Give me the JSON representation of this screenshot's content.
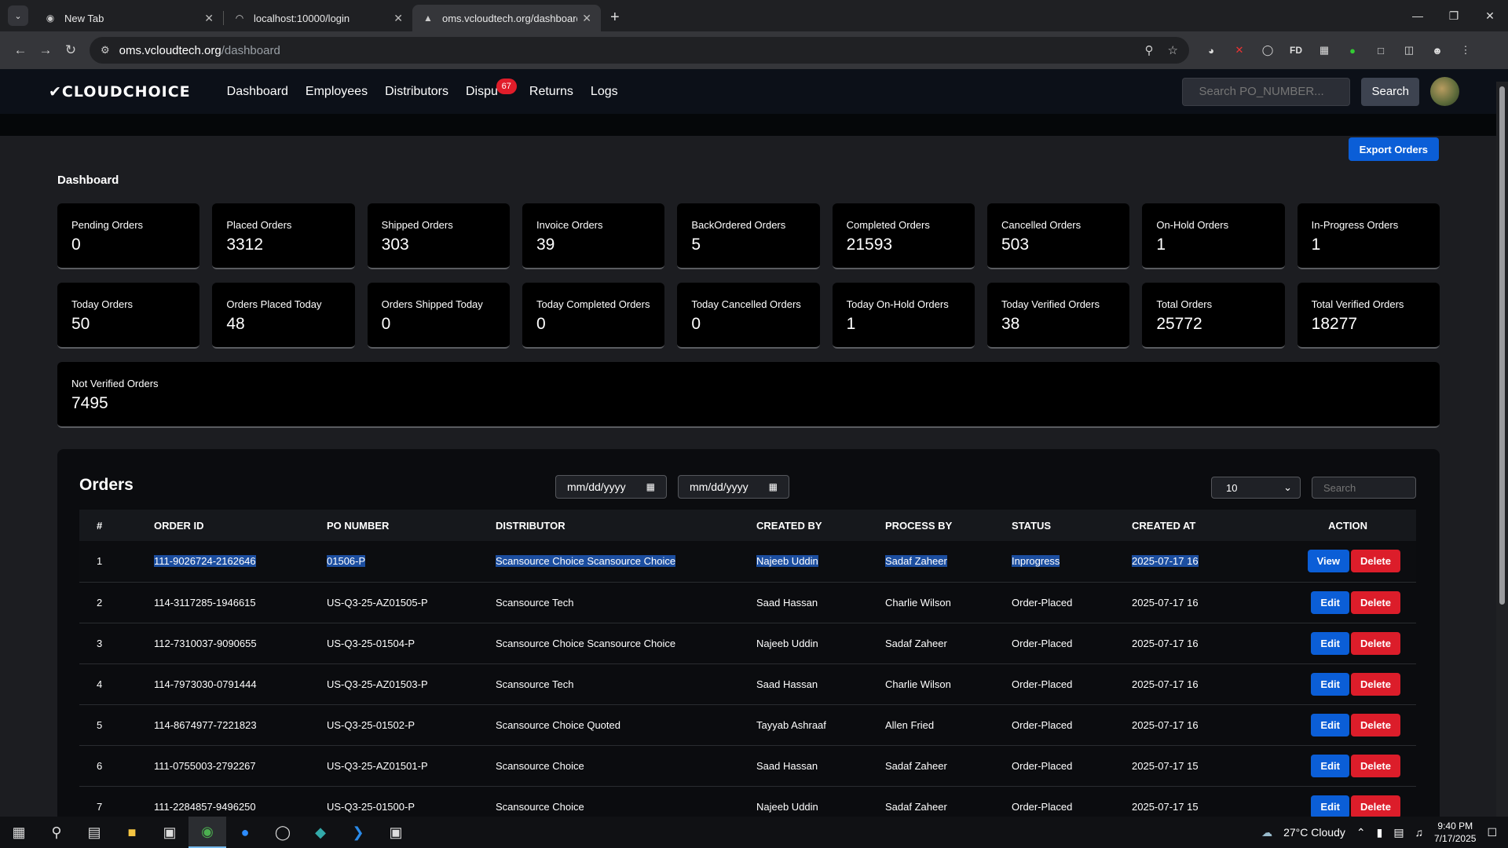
{
  "browser": {
    "tabs": [
      {
        "title": "New Tab",
        "icon": "chrome-icon",
        "active": false
      },
      {
        "title": "localhost:10000/login",
        "icon": "loading-icon",
        "active": false
      },
      {
        "title": "oms.vcloudtech.org/dashboard",
        "icon": "site-icon",
        "active": true
      }
    ],
    "url_host": "oms.vcloudtech.org",
    "url_path": "/dashboard"
  },
  "nav": {
    "logo": "CLOUDCHOICE",
    "links": [
      "Dashboard",
      "Employees",
      "Distributors",
      "Dispu",
      "Returns",
      "Logs"
    ],
    "disputes_badge": "67",
    "search_placeholder": "Search PO_NUMBER...",
    "search_button": "Search"
  },
  "dashboard": {
    "export_button": "Export Orders",
    "title": "Dashboard",
    "cards": [
      {
        "label": "Pending Orders",
        "value": "0"
      },
      {
        "label": "Placed Orders",
        "value": "3312"
      },
      {
        "label": "Shipped Orders",
        "value": "303"
      },
      {
        "label": "Invoice Orders",
        "value": "39"
      },
      {
        "label": "BackOrdered Orders",
        "value": "5"
      },
      {
        "label": "Completed Orders",
        "value": "21593"
      },
      {
        "label": "Cancelled Orders",
        "value": "503"
      },
      {
        "label": "On-Hold Orders",
        "value": "1"
      },
      {
        "label": "In-Progress Orders",
        "value": "1"
      },
      {
        "label": "Today Orders",
        "value": "50"
      },
      {
        "label": "Orders Placed Today",
        "value": "48"
      },
      {
        "label": "Orders Shipped Today",
        "value": "0"
      },
      {
        "label": "Today Completed Orders",
        "value": "0"
      },
      {
        "label": "Today Cancelled Orders",
        "value": "0"
      },
      {
        "label": "Today On-Hold Orders",
        "value": "1"
      },
      {
        "label": "Today Verified Orders",
        "value": "38"
      },
      {
        "label": "Total Orders",
        "value": "25772"
      },
      {
        "label": "Total Verified Orders",
        "value": "18277"
      },
      {
        "label": "Not Verified Orders",
        "value": "7495"
      }
    ]
  },
  "orders": {
    "title": "Orders",
    "date_from": "mm/dd/yyyy",
    "date_to": "mm/dd/yyyy",
    "page_size": "10",
    "search_placeholder": "Search",
    "columns": [
      "#",
      "ORDER ID",
      "PO NUMBER",
      "DISTRIBUTOR",
      "CREATED BY",
      "PROCESS BY",
      "STATUS",
      "CREATED AT",
      "ACTION"
    ],
    "rows": [
      {
        "n": "1",
        "order_id": "111-9026724-2162646",
        "po": "01506-P",
        "distributor": "Scansource Choice Scansource Choice",
        "created_by": "Najeeb Uddin",
        "process_by": "Sadaf Zaheer",
        "status": "Inprogress",
        "created_at": "2025-07-17 16",
        "primary": "View",
        "delete": "Delete"
      },
      {
        "n": "2",
        "order_id": "114-3117285-1946615",
        "po": "US-Q3-25-AZ01505-P",
        "distributor": "Scansource Tech",
        "created_by": "Saad Hassan",
        "process_by": "Charlie Wilson",
        "status": "Order-Placed",
        "created_at": "2025-07-17 16",
        "primary": "Edit",
        "delete": "Delete"
      },
      {
        "n": "3",
        "order_id": "112-7310037-9090655",
        "po": "US-Q3-25-01504-P",
        "distributor": "Scansource Choice Scansource Choice",
        "created_by": "Najeeb Uddin",
        "process_by": "Sadaf Zaheer",
        "status": "Order-Placed",
        "created_at": "2025-07-17 16",
        "primary": "Edit",
        "delete": "Delete"
      },
      {
        "n": "4",
        "order_id": "114-7973030-0791444",
        "po": "US-Q3-25-AZ01503-P",
        "distributor": "Scansource Tech",
        "created_by": "Saad Hassan",
        "process_by": "Charlie Wilson",
        "status": "Order-Placed",
        "created_at": "2025-07-17 16",
        "primary": "Edit",
        "delete": "Delete"
      },
      {
        "n": "5",
        "order_id": "114-8674977-7221823",
        "po": "US-Q3-25-01502-P",
        "distributor": "Scansource Choice Quoted",
        "created_by": "Tayyab Ashraaf",
        "process_by": "Allen Fried",
        "status": "Order-Placed",
        "created_at": "2025-07-17 16",
        "primary": "Edit",
        "delete": "Delete"
      },
      {
        "n": "6",
        "order_id": "111-0755003-2792267",
        "po": "US-Q3-25-AZ01501-P",
        "distributor": "Scansource Choice",
        "created_by": "Saad Hassan",
        "process_by": "Sadaf Zaheer",
        "status": "Order-Placed",
        "created_at": "2025-07-17 15",
        "primary": "Edit",
        "delete": "Delete"
      },
      {
        "n": "7",
        "order_id": "111-2284857-9496250",
        "po": "US-Q3-25-01500-P",
        "distributor": "Scansource Choice",
        "created_by": "Najeeb Uddin",
        "process_by": "Sadaf Zaheer",
        "status": "Order-Placed",
        "created_at": "2025-07-17 15",
        "primary": "Edit",
        "delete": "Delete"
      }
    ]
  },
  "taskbar": {
    "weather": "27°C  Cloudy",
    "time": "9:40 PM",
    "date": "7/17/2025"
  }
}
